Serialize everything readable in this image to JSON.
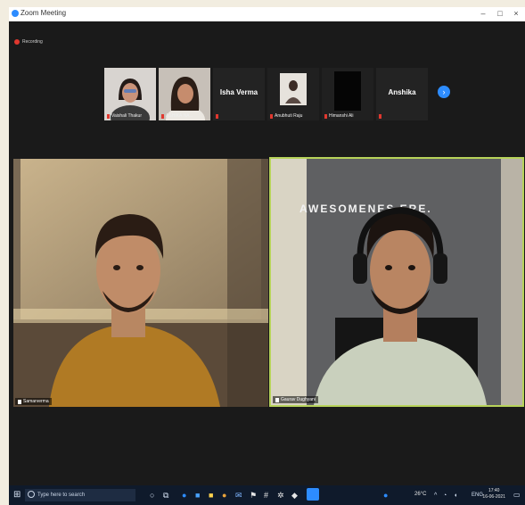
{
  "window": {
    "title": "Zoom Meeting",
    "min": "–",
    "max": "□",
    "close": "×"
  },
  "recording": {
    "label": "Recording"
  },
  "strip": {
    "thumbs": [
      {
        "name": "Vaishali Thakur"
      },
      {
        "name": "ASHIKA NA..."
      },
      {
        "big": "Isha Verma"
      },
      {
        "name": "Anubhuti Raju"
      },
      {
        "name": "Himanshi Ali"
      },
      {
        "big": "Anshika"
      }
    ],
    "next": "›"
  },
  "tiles": {
    "left": {
      "name": "Samarverma"
    },
    "right": {
      "name": "Gaurav Dughyani",
      "poster": "AWESOMENES   ERE."
    }
  },
  "taskbar": {
    "search_placeholder": "Type here to search",
    "weather": "26°C",
    "lang": "ENG",
    "time": "17:40",
    "date": "16-06-2021"
  }
}
